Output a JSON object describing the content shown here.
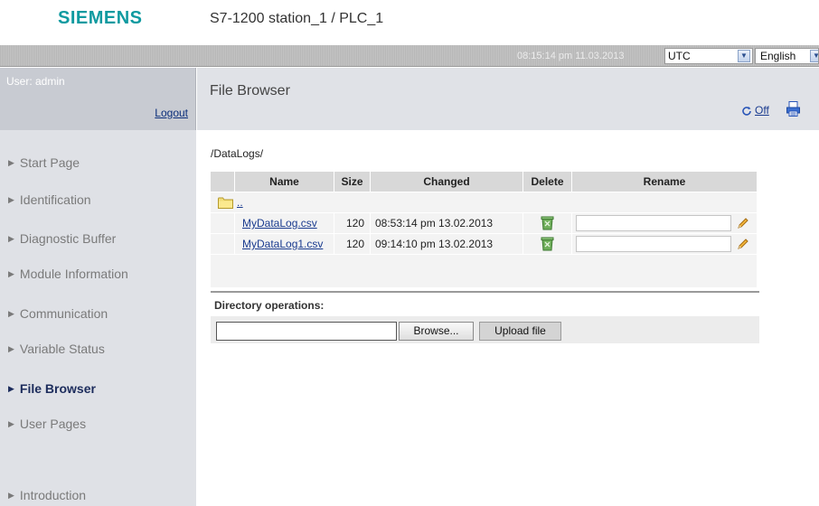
{
  "header": {
    "brand": "SIEMENS",
    "station": "S7-1200 station_1 / PLC_1",
    "datetime": "08:15:14 pm  11.03.2013",
    "timezone": "UTC",
    "language": "English"
  },
  "user": {
    "label": "User: admin",
    "logout": "Logout"
  },
  "sidebar": {
    "items": [
      {
        "label": "Start Page"
      },
      {
        "label": "Identification"
      },
      {
        "label": "Diagnostic Buffer"
      },
      {
        "label": "Module Information"
      },
      {
        "label": "Communication"
      },
      {
        "label": "Variable Status"
      },
      {
        "label": "File Browser"
      },
      {
        "label": "User Pages"
      },
      {
        "label": "Introduction"
      }
    ],
    "active": "File Browser"
  },
  "page": {
    "title": "File Browser",
    "refresh_label": "Off",
    "path": "/DataLogs/"
  },
  "table": {
    "columns": [
      "Name",
      "Size",
      "Changed",
      "Delete",
      "Rename"
    ],
    "parent_link": "..",
    "rows": [
      {
        "name": "MyDataLog.csv",
        "size": "120",
        "changed": "08:53:14 pm 13.02.2013"
      },
      {
        "name": "MyDataLog1.csv",
        "size": "120",
        "changed": "09:14:10 pm 13.02.2013"
      }
    ]
  },
  "directory_operations": {
    "label": "Directory operations:",
    "browse_label": "Browse...",
    "upload_label": "Upload file"
  },
  "colors": {
    "brand": "#0f9aa0",
    "link": "#1a3b8f",
    "active_nav": "#1c2c5c"
  }
}
